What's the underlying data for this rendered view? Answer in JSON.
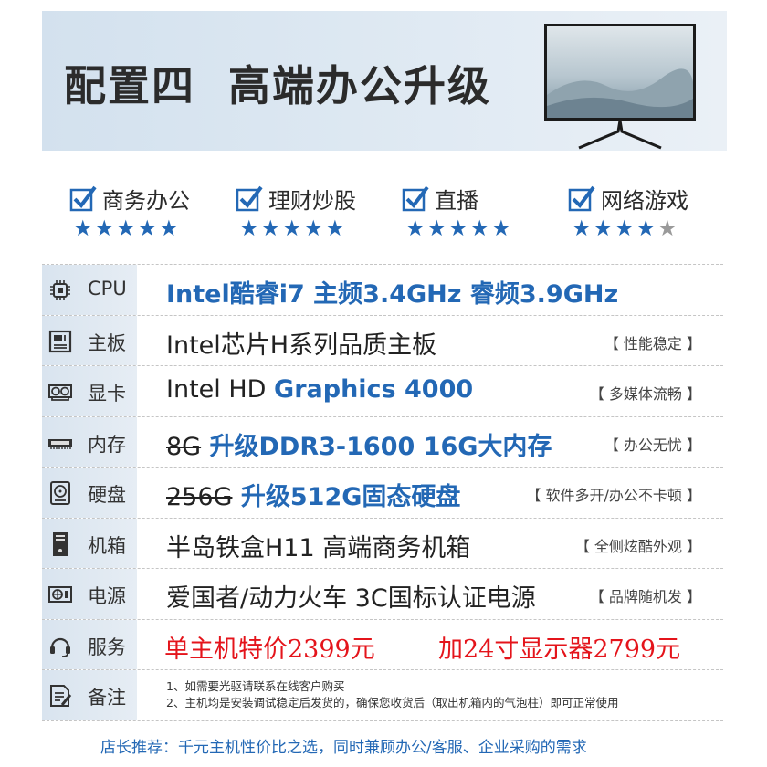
{
  "banner": {
    "config": "配置四",
    "title": "高端办公升级"
  },
  "features": [
    {
      "label": "商务办公",
      "rating": 5,
      "max": 5
    },
    {
      "label": "理财炒股",
      "rating": 5,
      "max": 5
    },
    {
      "label": "直播",
      "rating": 5,
      "max": 5
    },
    {
      "label": "网络游戏",
      "rating": 4,
      "max": 5
    }
  ],
  "colors": {
    "accent": "#2368b5",
    "price": "#e4141b",
    "header_bg": "#dde8f2"
  },
  "specs": {
    "cpu": {
      "label": "CPU",
      "icon": "cpu-icon",
      "main": "Intel酷睿i7  主频3.4GHz  睿频3.9GHz"
    },
    "board": {
      "label": "主板",
      "icon": "motherboard-icon",
      "main": "Intel芯片H系列品质主板",
      "note": "【 性能稳定 】"
    },
    "gpu": {
      "label": "显卡",
      "icon": "graphics-card-icon",
      "main_prefix": "Intel HD ",
      "main_highlight": "Graphics 4000",
      "note": "【 多媒体流畅 】"
    },
    "ram": {
      "label": "内存",
      "icon": "memory-icon",
      "old": "8G",
      "main": " 升级DDR3-1600  16G大内存",
      "note": "【 办公无忧 】"
    },
    "disk": {
      "label": "硬盘",
      "icon": "hard-disk-icon",
      "old": "256G",
      "main": " 升级512G固态硬盘",
      "note": "【 软件多开/办公不卡顿 】"
    },
    "case": {
      "label": "机箱",
      "icon": "case-icon",
      "main": "半岛铁盒H11 高端商务机箱",
      "note": "【 全侧炫酷外观 】"
    },
    "psu": {
      "label": "电源",
      "icon": "power-supply-icon",
      "main": "爱国者/动力火车 3C国标认证电源",
      "note": "【 品牌随机发 】"
    },
    "service": {
      "label": "服务",
      "icon": "headset-icon",
      "price1": "单主机特价2399元",
      "price2": "加24寸显示器2799元"
    },
    "notes": {
      "label": "备注",
      "icon": "note-icon",
      "line1": "1、如需要光驱请联系在线客户购买",
      "line2": "2、主机均是安装调试稳定后发货的，确保您收货后（取出机箱内的气泡柱）即可正常使用"
    }
  },
  "footer": "店长推荐：千元主机性价比之选，同时兼顾办公/客服、企业采购的需求"
}
